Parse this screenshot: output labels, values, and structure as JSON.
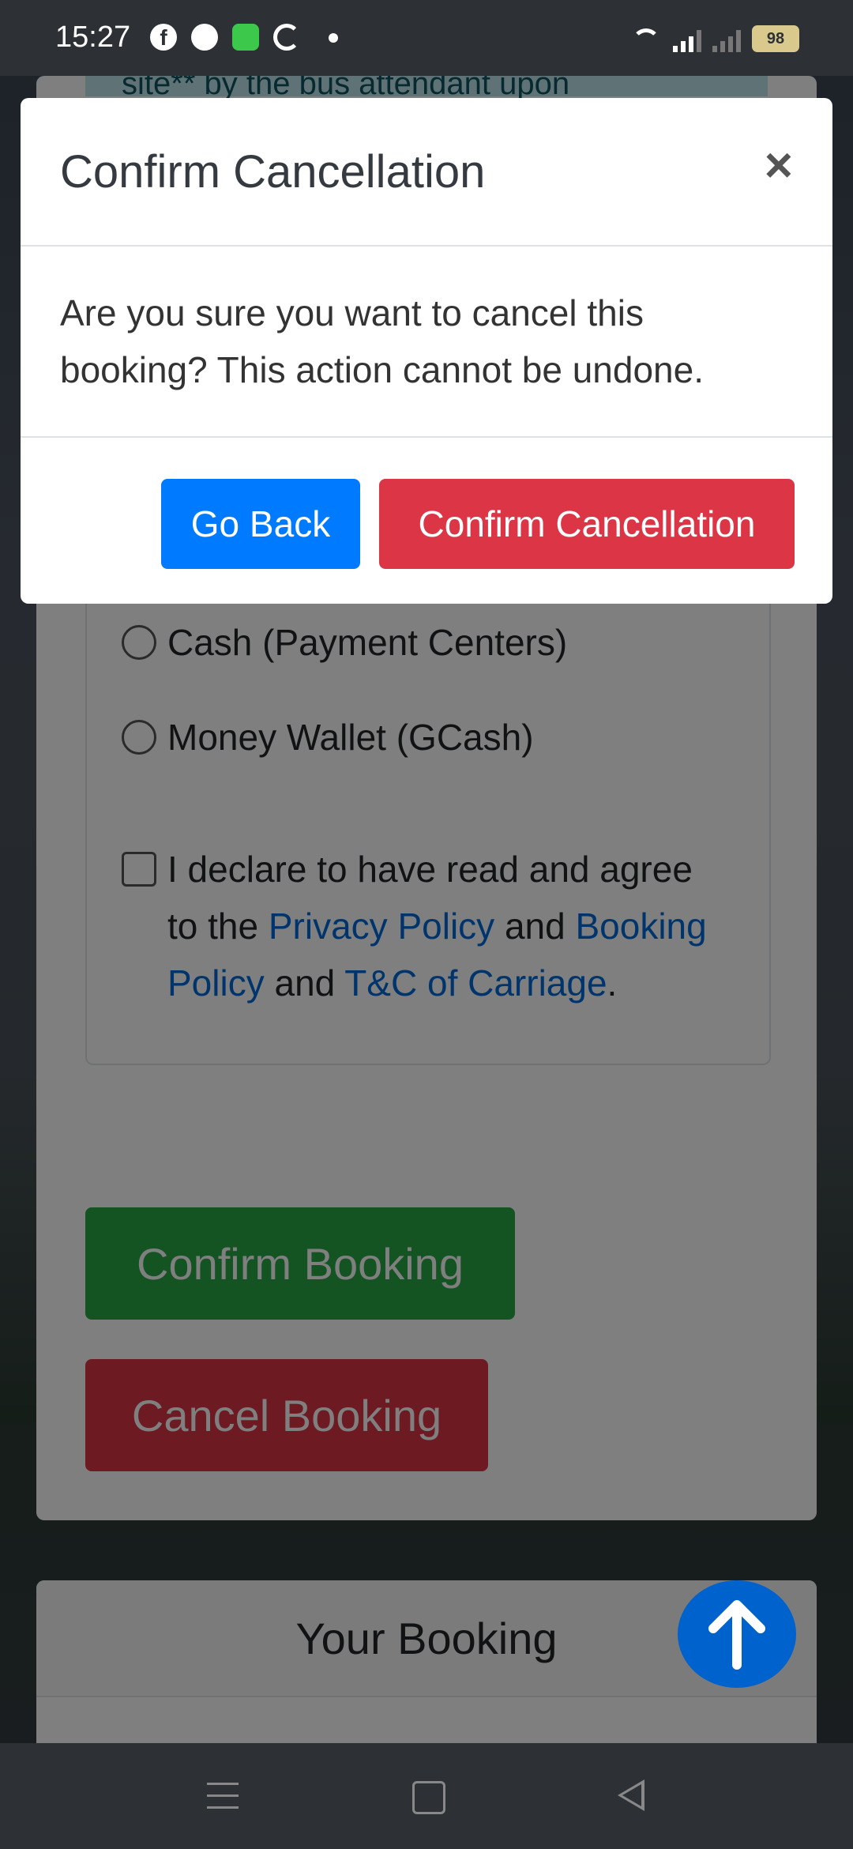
{
  "status_bar": {
    "time": "15:27",
    "battery": "98",
    "icons": [
      "facebook-icon",
      "messenger-icon",
      "chat-icon",
      "g-icon",
      "dot-icon",
      "wifi-icon",
      "signal-icon",
      "signal-icon-2",
      "battery-icon"
    ]
  },
  "page": {
    "top_notice_fragment": "site** by the bus attendant upon",
    "payment_options": [
      {
        "label": "Cash (Payment Centers)"
      },
      {
        "label": "Money Wallet (GCash)"
      }
    ],
    "declaration": {
      "prefix": "I declare to have read and agree to the ",
      "privacy_link": "Privacy Policy",
      "and1": " and ",
      "booking_link": "Booking Policy",
      "and2": " and ",
      "tc_link": "T&C of Carriage",
      "suffix": "."
    },
    "confirm_booking_label": "Confirm Booking",
    "cancel_booking_label": "Cancel Booking",
    "your_booking_title": "Your Booking"
  },
  "modal": {
    "title": "Confirm Cancellation",
    "close_symbol": "×",
    "body": "Are you sure you want to cancel this booking? This action cannot be undone.",
    "go_back_label": "Go Back",
    "confirm_label": "Confirm Cancellation"
  },
  "colors": {
    "primary": "#007bff",
    "danger": "#dc3545",
    "success": "#28a745",
    "link": "#0069d9"
  }
}
